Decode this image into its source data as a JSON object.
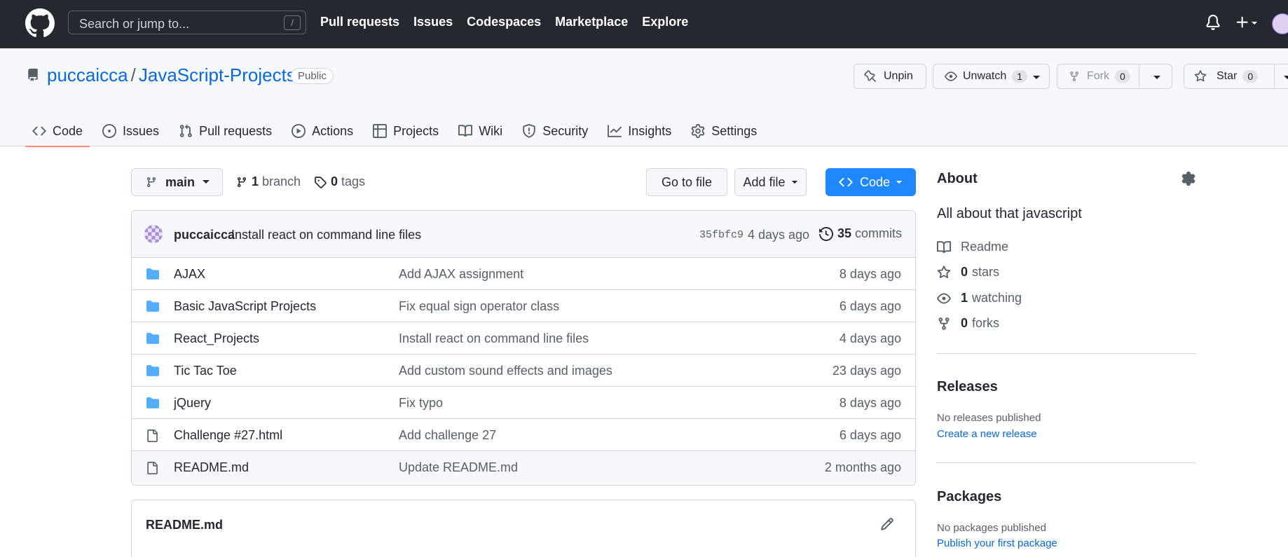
{
  "header": {
    "search_placeholder": "Search or jump to...",
    "search_shortcut": "/",
    "nav": [
      "Pull requests",
      "Issues",
      "Codespaces",
      "Marketplace",
      "Explore"
    ]
  },
  "repo": {
    "owner": "puccaicca",
    "separator": "/",
    "name": "JavaScript-Projects",
    "visibility": "Public",
    "actions": {
      "unpin": "Unpin",
      "watch": "Unwatch",
      "watch_count": "1",
      "fork": "Fork",
      "fork_count": "0",
      "star": "Star",
      "star_count": "0"
    },
    "tabs": [
      "Code",
      "Issues",
      "Pull requests",
      "Actions",
      "Projects",
      "Wiki",
      "Security",
      "Insights",
      "Settings"
    ]
  },
  "toolbar": {
    "branch": "main",
    "branch_count": "1",
    "branch_label": "branch",
    "tag_count": "0",
    "tag_label": "tags",
    "go_to_file": "Go to file",
    "add_file": "Add file",
    "code": "Code"
  },
  "latest_commit": {
    "author": "puccaicca",
    "message": "Install react on command line files",
    "sha": "35fbfc9",
    "age": "4 days ago",
    "commit_count": "35",
    "commit_label": "commits"
  },
  "files": [
    {
      "type": "dir",
      "name": "AJAX",
      "message": "Add AJAX assignment",
      "age": "8 days ago"
    },
    {
      "type": "dir",
      "name": "Basic JavaScript Projects",
      "message": "Fix equal sign operator class",
      "age": "6 days ago"
    },
    {
      "type": "dir",
      "name": "React_Projects",
      "message": "Install react on command line files",
      "age": "4 days ago"
    },
    {
      "type": "dir",
      "name": "Tic Tac Toe",
      "message": "Add custom sound effects and images",
      "age": "23 days ago"
    },
    {
      "type": "dir",
      "name": "jQuery",
      "message": "Fix typo",
      "age": "8 days ago"
    },
    {
      "type": "file",
      "name": "Challenge #27.html",
      "message": "Add challenge 27",
      "age": "6 days ago"
    },
    {
      "type": "file",
      "name": "README.md",
      "message": "Update README.md",
      "age": "2 months ago"
    }
  ],
  "readme": {
    "title": "README.md"
  },
  "sidebar": {
    "about_title": "About",
    "description": "All about that javascript",
    "readme": "Readme",
    "stars_count": "0",
    "stars_label": "stars",
    "watching_count": "1",
    "watching_label": "watching",
    "forks_count": "0",
    "forks_label": "forks",
    "releases_title": "Releases",
    "releases_note": "No releases published",
    "releases_link": "Create a new release",
    "packages_title": "Packages",
    "packages_note": "No packages published",
    "packages_link": "Publish your first package"
  },
  "colors": {
    "header_bg": "#24292f",
    "link_blue": "#0969da",
    "code_button": "#1f88ff",
    "folder_blue": "#54aeff",
    "active_tab_underline": "#fd8c73"
  },
  "icons": {
    "logo": "github-mark-icon",
    "folder": "folder-icon",
    "file": "file-icon"
  }
}
